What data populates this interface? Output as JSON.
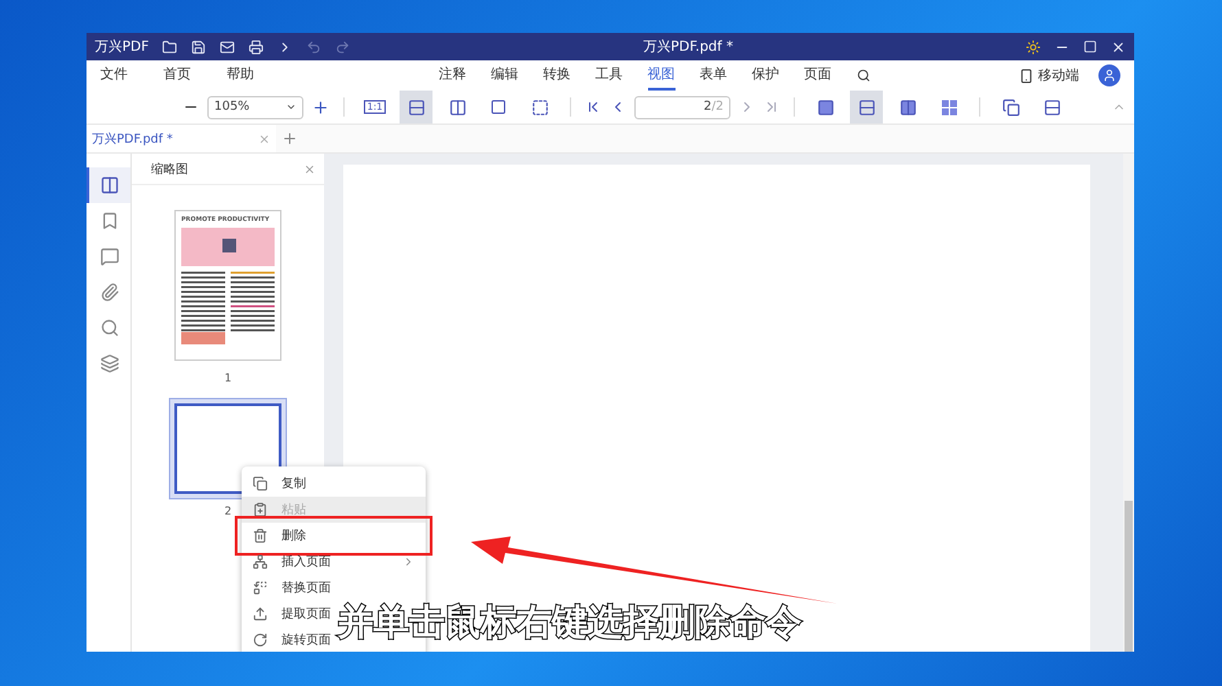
{
  "window": {
    "app_name": "万兴PDF",
    "title": "万兴PDF.pdf *"
  },
  "menu_left": [
    {
      "label": "文件"
    },
    {
      "label": "首页"
    },
    {
      "label": "帮助"
    }
  ],
  "menu_tabs": [
    {
      "label": "注释",
      "selected": false
    },
    {
      "label": "编辑",
      "selected": false
    },
    {
      "label": "转换",
      "selected": false
    },
    {
      "label": "工具",
      "selected": false
    },
    {
      "label": "视图",
      "selected": true
    },
    {
      "label": "表单",
      "selected": false
    },
    {
      "label": "保护",
      "selected": false
    },
    {
      "label": "页面",
      "selected": false
    }
  ],
  "mobile_link": {
    "label": "移动端"
  },
  "zoom": {
    "value": "105%"
  },
  "fit_modes": [
    {
      "kind": "actual",
      "label": "1:1",
      "selected": false
    },
    {
      "kind": "width",
      "selected": true
    },
    {
      "kind": "height",
      "selected": false
    },
    {
      "kind": "page",
      "selected": false
    },
    {
      "kind": "full",
      "selected": false
    }
  ],
  "page_nav": {
    "value": "2",
    "total": "/2"
  },
  "page_layouts": [
    {
      "kind": "single",
      "selected": false
    },
    {
      "kind": "scroll",
      "selected": true
    },
    {
      "kind": "double",
      "selected": false
    },
    {
      "kind": "grid",
      "selected": false
    }
  ],
  "document_tab": {
    "label": "万兴PDF.pdf *"
  },
  "sidebar_rail": [
    {
      "kind": "thumbnails",
      "selected": true
    },
    {
      "kind": "bookmark",
      "selected": false
    },
    {
      "kind": "comment",
      "selected": false
    },
    {
      "kind": "attachment",
      "selected": false
    },
    {
      "kind": "search",
      "selected": false
    },
    {
      "kind": "layers",
      "selected": false
    }
  ],
  "thumbnail_panel": {
    "title": "缩略图",
    "pages": [
      {
        "number": "1",
        "heading": "PROMOTE PRODUCTIVITY",
        "selected": false
      },
      {
        "number": "2",
        "selected": true
      }
    ]
  },
  "context_menu": [
    {
      "kind": "copy",
      "label": "复制",
      "disabled": false,
      "hovered": false,
      "submenu": false
    },
    {
      "kind": "paste",
      "label": "粘贴",
      "disabled": true,
      "hovered": true,
      "submenu": false
    },
    {
      "kind": "delete",
      "label": "删除",
      "disabled": false,
      "hovered": false,
      "submenu": false,
      "highlighted": true
    },
    {
      "kind": "insert",
      "label": "插入页面",
      "disabled": false,
      "hovered": false,
      "submenu": true
    },
    {
      "kind": "replace",
      "label": "替换页面",
      "disabled": false,
      "hovered": false,
      "submenu": false
    },
    {
      "kind": "extract",
      "label": "提取页面",
      "disabled": false,
      "hovered": false,
      "submenu": false
    },
    {
      "kind": "rotate",
      "label": "旋转页面",
      "disabled": false,
      "hovered": false,
      "submenu": false
    }
  ],
  "caption": "并单击鼠标右键选择删除命令"
}
